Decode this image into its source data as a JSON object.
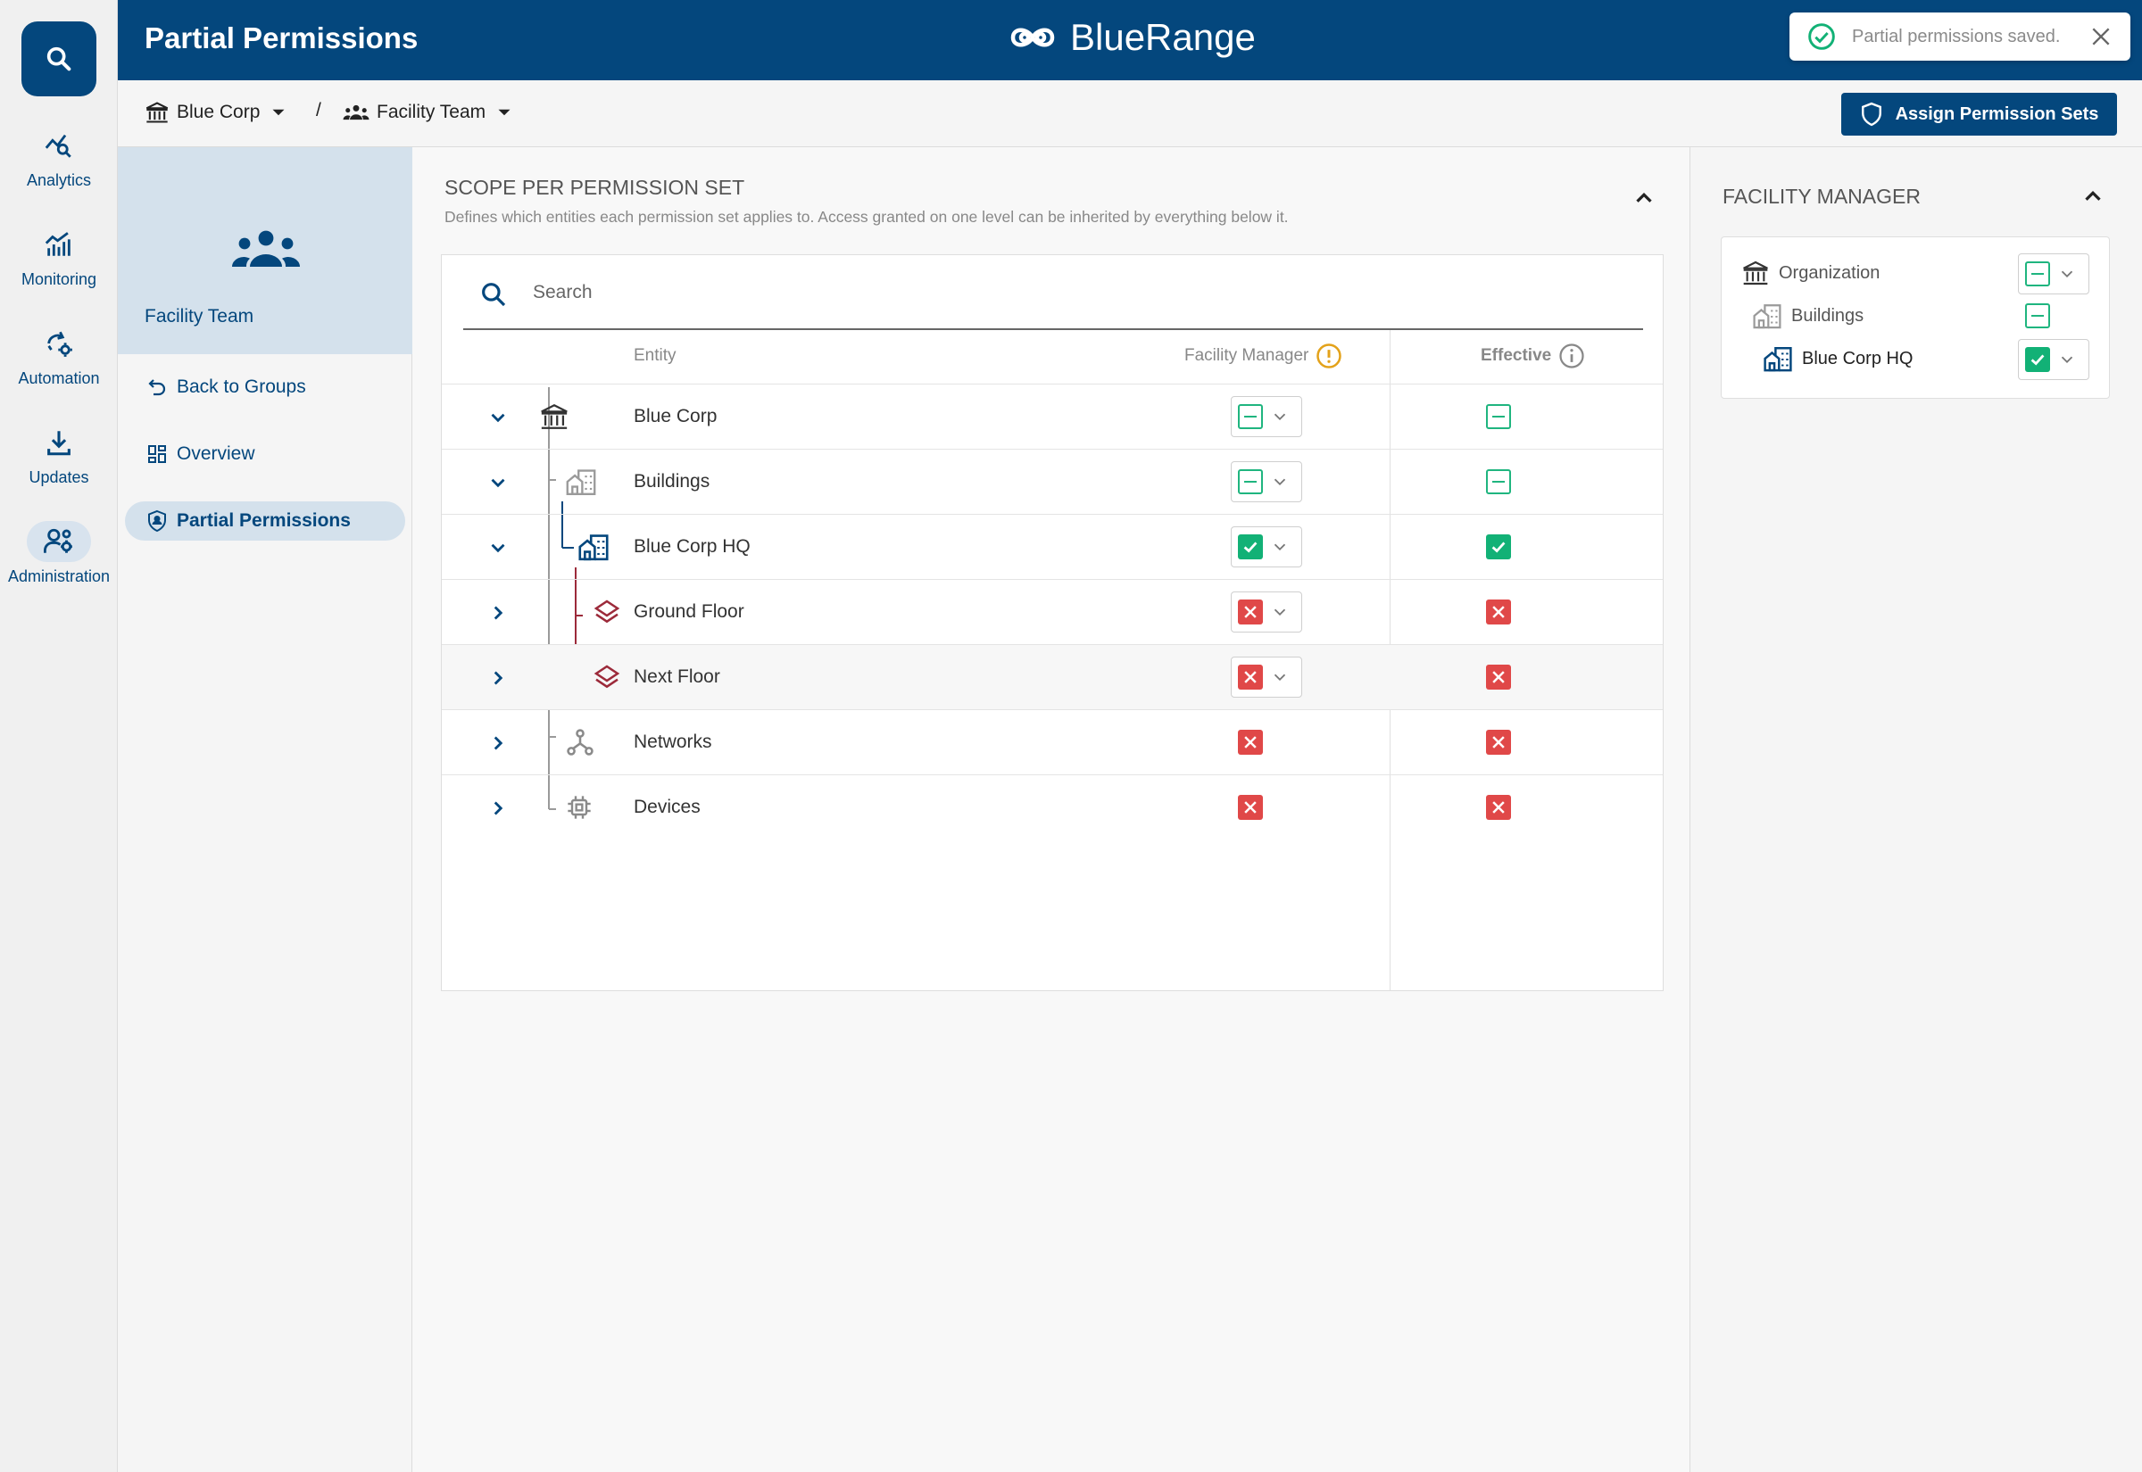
{
  "app": {
    "page_title": "Partial Permissions",
    "brand": "BlueRange"
  },
  "toast": {
    "message": "Partial permissions saved."
  },
  "rail": {
    "items": [
      {
        "label": "Analytics",
        "icon": "analytics-icon"
      },
      {
        "label": "Monitoring",
        "icon": "monitoring-icon"
      },
      {
        "label": "Automation",
        "icon": "automation-icon"
      },
      {
        "label": "Updates",
        "icon": "updates-icon"
      },
      {
        "label": "Administration",
        "icon": "administration-icon",
        "active": true
      }
    ]
  },
  "breadcrumb": {
    "org": "Blue Corp",
    "separator": "/",
    "group": "Facility Team"
  },
  "actions": {
    "assign": "Assign Permission Sets"
  },
  "group": {
    "name": "Facility Team"
  },
  "nav": [
    {
      "label": "Back to Groups"
    },
    {
      "label": "Overview"
    },
    {
      "label": "Partial Permissions",
      "active": true
    }
  ],
  "scope": {
    "title": "SCOPE PER PERMISSION SET",
    "description": "Defines which entities each permission set applies to. Access granted on one level can be inherited by everything below it.",
    "search_placeholder": "Search",
    "columns": {
      "entity": "Entity",
      "permission_set": "Facility Manager",
      "effective": "Effective"
    },
    "rows": [
      {
        "label": "Blue Corp",
        "set": "partial",
        "effective": "partial",
        "expanded": true,
        "dropdown": true
      },
      {
        "label": "Buildings",
        "set": "partial",
        "effective": "partial",
        "expanded": true,
        "dropdown": true
      },
      {
        "label": "Blue Corp HQ",
        "set": "full",
        "effective": "full",
        "expanded": true,
        "dropdown": true
      },
      {
        "label": "Ground Floor",
        "set": "none",
        "effective": "none",
        "expanded": false,
        "dropdown": true
      },
      {
        "label": "Next Floor",
        "set": "none",
        "effective": "none",
        "expanded": false,
        "dropdown": true
      },
      {
        "label": "Networks",
        "set": "none",
        "effective": "none",
        "expanded": false,
        "dropdown": false
      },
      {
        "label": "Devices",
        "set": "none",
        "effective": "none",
        "expanded": false,
        "dropdown": false
      }
    ]
  },
  "facility_manager": {
    "title": "FACILITY MANAGER",
    "items": [
      {
        "label": "Organization",
        "state": "partial",
        "dropdown": true
      },
      {
        "label": "Buildings",
        "state": "partial",
        "dropdown": false
      },
      {
        "label": "Blue Corp HQ",
        "state": "full",
        "dropdown": true
      }
    ]
  },
  "colors": {
    "primary": "#04477d",
    "success": "#12b176",
    "danger": "#e04848",
    "warning": "#e3a21a",
    "floor": "#9c2a3a"
  }
}
